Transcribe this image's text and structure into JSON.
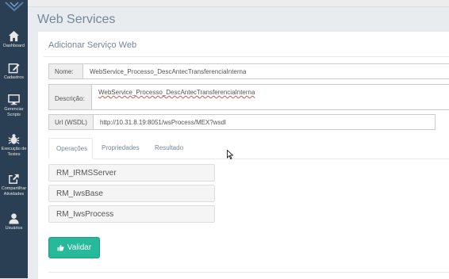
{
  "sidebar": {
    "items": [
      {
        "label": "Dashboard",
        "icon": "home-icon"
      },
      {
        "label": "Cadastros",
        "icon": "edit-icon"
      },
      {
        "label": "Gerenciar Scripts",
        "icon": "monitor-icon"
      },
      {
        "label": "Execução de Testes",
        "icon": "bug-icon"
      },
      {
        "label": "Compartilhar Atividades",
        "icon": "share-icon"
      },
      {
        "label": "Usuários",
        "icon": "user-icon"
      }
    ]
  },
  "page": {
    "title": "Web Services"
  },
  "panel": {
    "title": "Adicionar Serviço Web"
  },
  "form": {
    "nome_label": "Nome:",
    "nome_value": "WebService_Processo_DescAntecTransferenciaInterna",
    "descricao_label": "Descrição:",
    "descricao_value": "WebService_Processo_DescAntecTransferenciaInterna",
    "url_label": "Url (WSDL)",
    "url_value": "http://10.31.8.19:8051/wsProcess/MEX?wsdl"
  },
  "tabs": [
    {
      "label": "Operações",
      "active": true
    },
    {
      "label": "Propriedades",
      "active": false
    },
    {
      "label": "Resultado",
      "active": false
    }
  ],
  "operations": [
    "RM_IRMSServer",
    "RM_IwsBase",
    "RM_IwsProcess"
  ],
  "actions": {
    "validar_label": "Validar"
  },
  "colors": {
    "sidebar": "#2a3f54",
    "primary_button": "#26b99a",
    "title_text": "#73879c"
  }
}
